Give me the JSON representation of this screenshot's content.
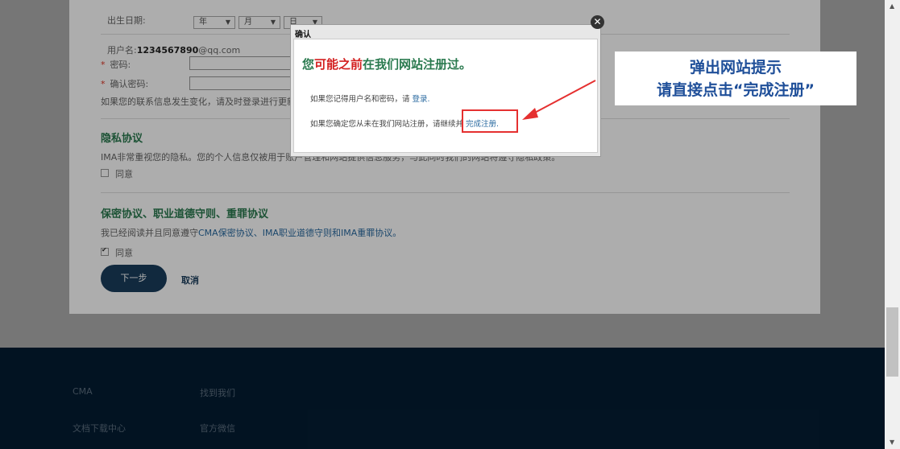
{
  "form": {
    "birthdate_label": "出生日期:",
    "year": "年",
    "month": "月",
    "day": "日",
    "username_label": "用户名:",
    "username_bold": "1234567890",
    "username_rest": "@qq.com",
    "password_label": "密码:",
    "confirm_password_label": "确认密码:",
    "update_note": "如果您的联系信息发生变化，请及时登录进行更新。"
  },
  "privacy": {
    "title": "隐私协议",
    "text": "IMA非常重视您的隐私。您的个人信息仅被用于账户管理和网站提供信息服务，与此同时我们的网站将遵守隐私政策。",
    "agree": "同意",
    "checked": false
  },
  "confidentiality": {
    "title": "保密协议、职业道德守则、重罪协议",
    "text_prefix": "我已经阅读并且同意遵守",
    "text_link": "CMA保密协议、IMA职业道德守则和IMA重罪协议。",
    "agree": "同意",
    "checked": true
  },
  "actions": {
    "next": "下一步",
    "cancel": "取消"
  },
  "footer": {
    "col1": [
      "CMA",
      "文档下载中心"
    ],
    "col2": [
      "找到我们",
      "官方微信"
    ]
  },
  "dialog": {
    "title": "确认",
    "heading_part1": "您",
    "heading_part2": "可能之前",
    "heading_part3": "在我们网站注册过。",
    "line1_text": "如果您记得用户名和密码，请",
    "line1_link": "登录.",
    "line2_text": "如果您确定您从未在我们网站注册，请继续并",
    "line2_link": "完成注册.",
    "close_glyph": "✕"
  },
  "callout": {
    "line1": "弹出网站提示",
    "line2": "请直接点击“完成注册”"
  },
  "colors": {
    "accent_green": "#2a7a4f",
    "accent_red": "#d32020",
    "navy": "#1a3d5c",
    "callout_blue": "#1f4f99"
  }
}
